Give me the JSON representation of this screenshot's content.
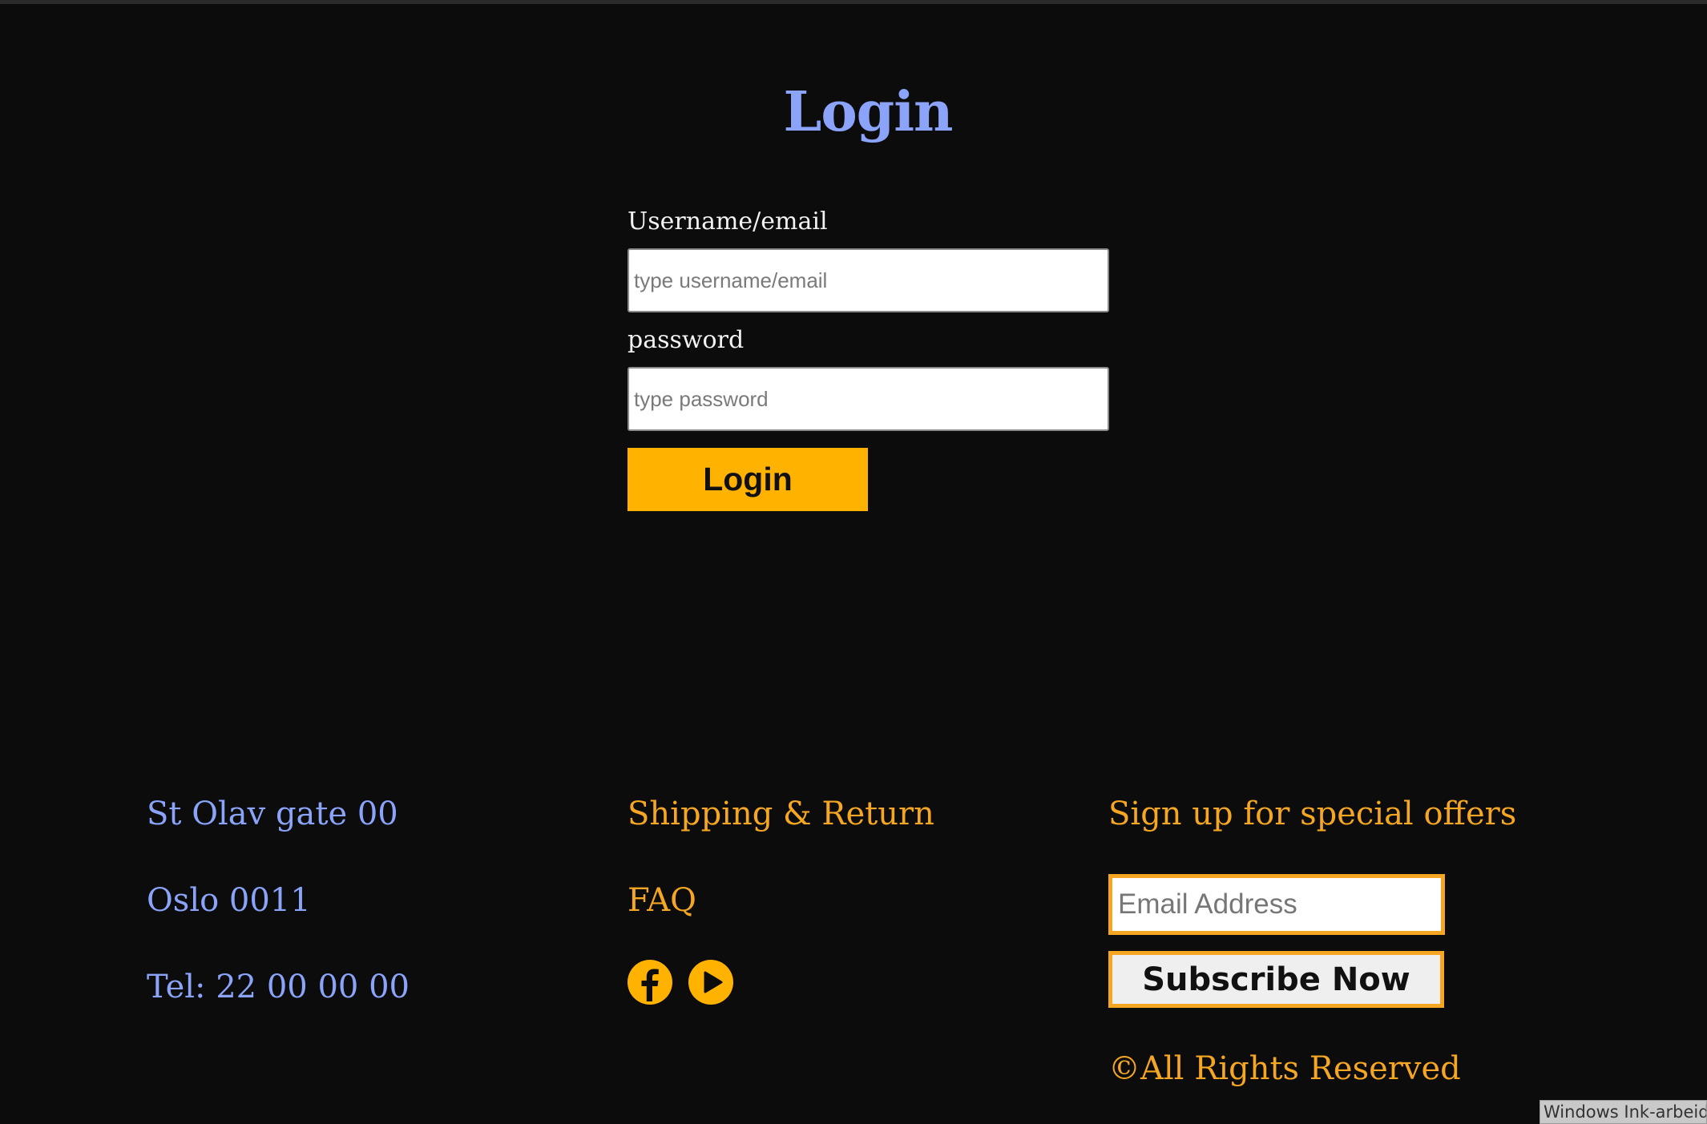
{
  "login": {
    "title": "Login",
    "username_label": "Username/email",
    "username_placeholder": "type username/email",
    "password_label": "password",
    "password_placeholder": "type password",
    "button_label": "Login"
  },
  "footer": {
    "address": {
      "street": "St Olav gate 00",
      "city": "Oslo 0011",
      "phone": "Tel: 22 00 00 00"
    },
    "links": {
      "shipping": "Shipping & Return",
      "faq": "FAQ"
    },
    "social_icons": [
      "facebook-icon",
      "youtube-icon"
    ],
    "newsletter": {
      "heading": "Sign up for special offers",
      "email_placeholder": "Email Address",
      "button_label": "Subscribe Now"
    },
    "copyright": "©All Rights Reserved"
  },
  "overlay": {
    "ink_workspace": "Windows Ink-arbeidsområde"
  },
  "colors": {
    "background": "#0c0c0c",
    "accent_blue": "#8ba4f9",
    "accent_orange": "#f5a623",
    "button_yellow": "#ffb300"
  }
}
